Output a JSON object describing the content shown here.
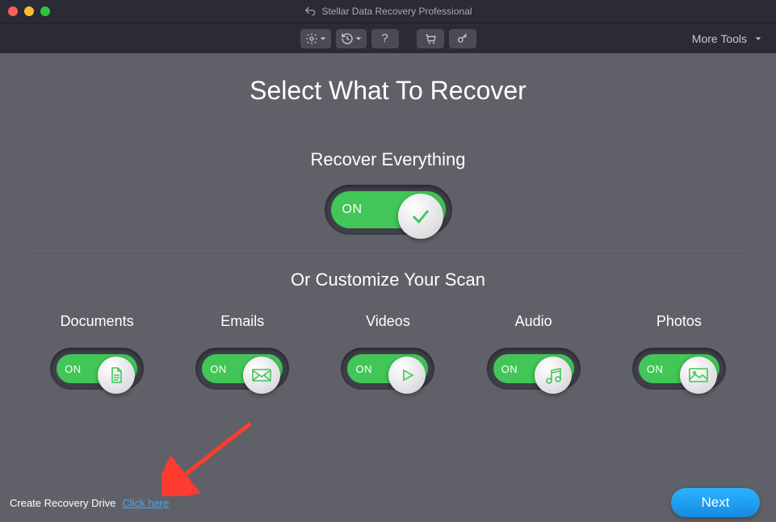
{
  "app": {
    "title": "Stellar Data Recovery Professional"
  },
  "toolbar": {
    "more_tools": "More Tools"
  },
  "main": {
    "title": "Select What To Recover",
    "recover_everything": "Recover Everything",
    "main_toggle_label": "ON",
    "customize": "Or Customize Your Scan"
  },
  "categories": [
    {
      "label": "Documents",
      "state": "ON",
      "icon": "document-icon"
    },
    {
      "label": "Emails",
      "state": "ON",
      "icon": "email-icon"
    },
    {
      "label": "Videos",
      "state": "ON",
      "icon": "video-icon"
    },
    {
      "label": "Audio",
      "state": "ON",
      "icon": "audio-icon"
    },
    {
      "label": "Photos",
      "state": "ON",
      "icon": "photo-icon"
    }
  ],
  "footer": {
    "create_recovery": "Create Recovery Drive",
    "click_here": "Click here",
    "next": "Next"
  }
}
